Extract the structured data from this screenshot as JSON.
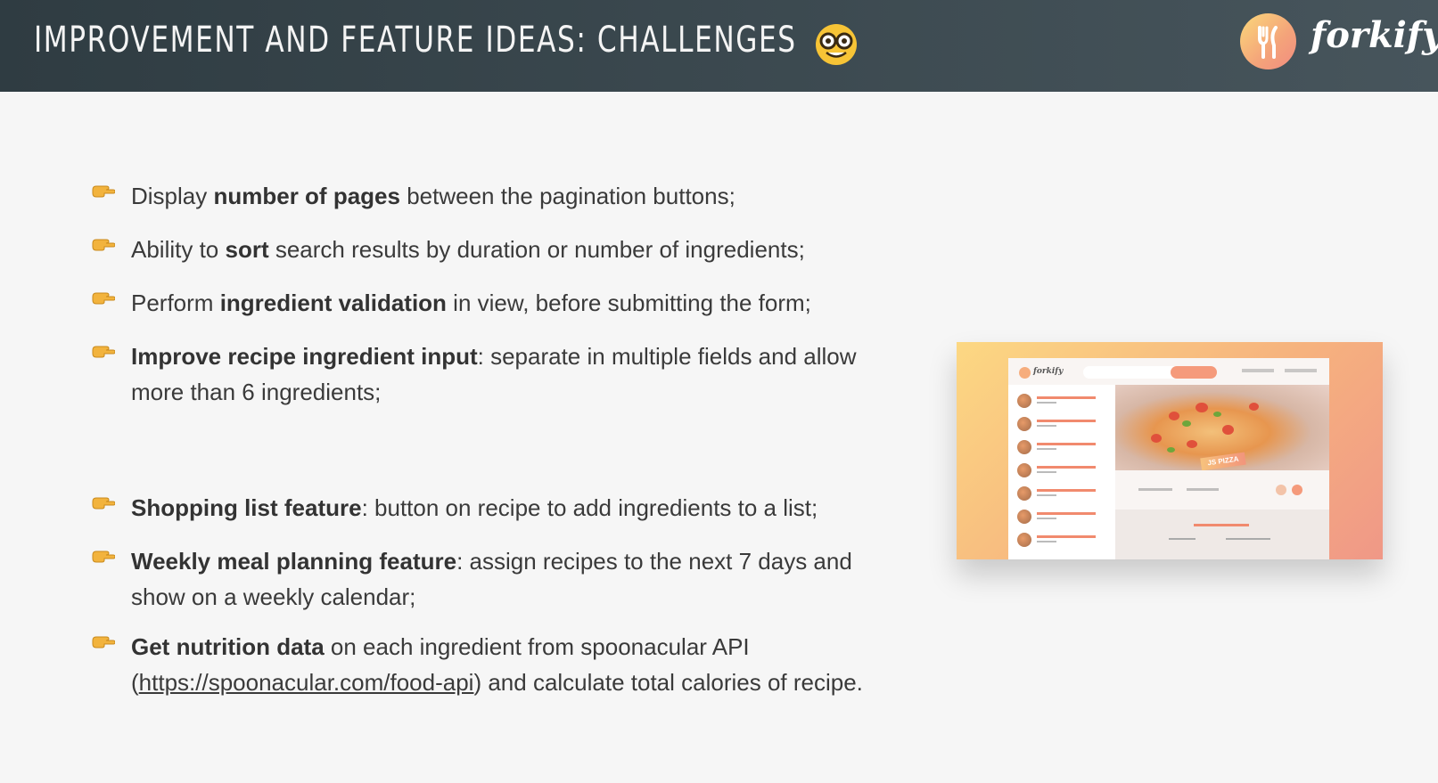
{
  "header": {
    "title": "Improvement and feature ideas: Challenges",
    "title_emoji": "nerd-face-emoji",
    "logo_text": "forkify",
    "logo_icon": "fork-knife-icon",
    "colors": {
      "header_bg": "#2f3c42",
      "accent_start": "#fbdb89",
      "accent_end": "#f38e82"
    }
  },
  "bullets": [
    {
      "icon": "pointing-hand-icon",
      "parts": [
        {
          "t": "Display "
        },
        {
          "t": "number of pages",
          "b": true
        },
        {
          "t": " between the pagination buttons;"
        }
      ]
    },
    {
      "icon": "pointing-hand-icon",
      "parts": [
        {
          "t": "Ability to "
        },
        {
          "t": "sort",
          "b": true
        },
        {
          "t": " search results by duration or number of ingredients;"
        }
      ]
    },
    {
      "icon": "pointing-hand-icon",
      "parts": [
        {
          "t": "Perform "
        },
        {
          "t": "ingredient validation",
          "b": true
        },
        {
          "t": " in view, before submitting the form;"
        }
      ]
    },
    {
      "icon": "pointing-hand-icon",
      "parts": [
        {
          "t": "Improve recipe ingredient input",
          "b": true
        },
        {
          "t": ": separate in multiple fields and allow more than 6 ingredients;"
        }
      ]
    },
    {
      "icon": "pointing-hand-icon",
      "parts": [
        {
          "t": "Shopping list feature",
          "b": true
        },
        {
          "t": ": button on recipe to add ingredients to a list;"
        }
      ]
    },
    {
      "icon": "pointing-hand-icon",
      "parts": [
        {
          "t": "Weekly meal planning feature",
          "b": true
        },
        {
          "t": ": assign recipes to the next 7 days and show on a weekly calendar;"
        }
      ]
    },
    {
      "icon": "pointing-hand-icon",
      "parts": [
        {
          "t": "Get nutrition data",
          "b": true
        },
        {
          "t": " on each ingredient from spoonacular API ("
        },
        {
          "t": "https://spoonacular.com/food-api",
          "u": true
        },
        {
          "t": ") and calculate total calories of recipe."
        }
      ]
    }
  ],
  "preview": {
    "image": "forkify-app-screenshot",
    "recipe_title": "JS PIZZA"
  }
}
